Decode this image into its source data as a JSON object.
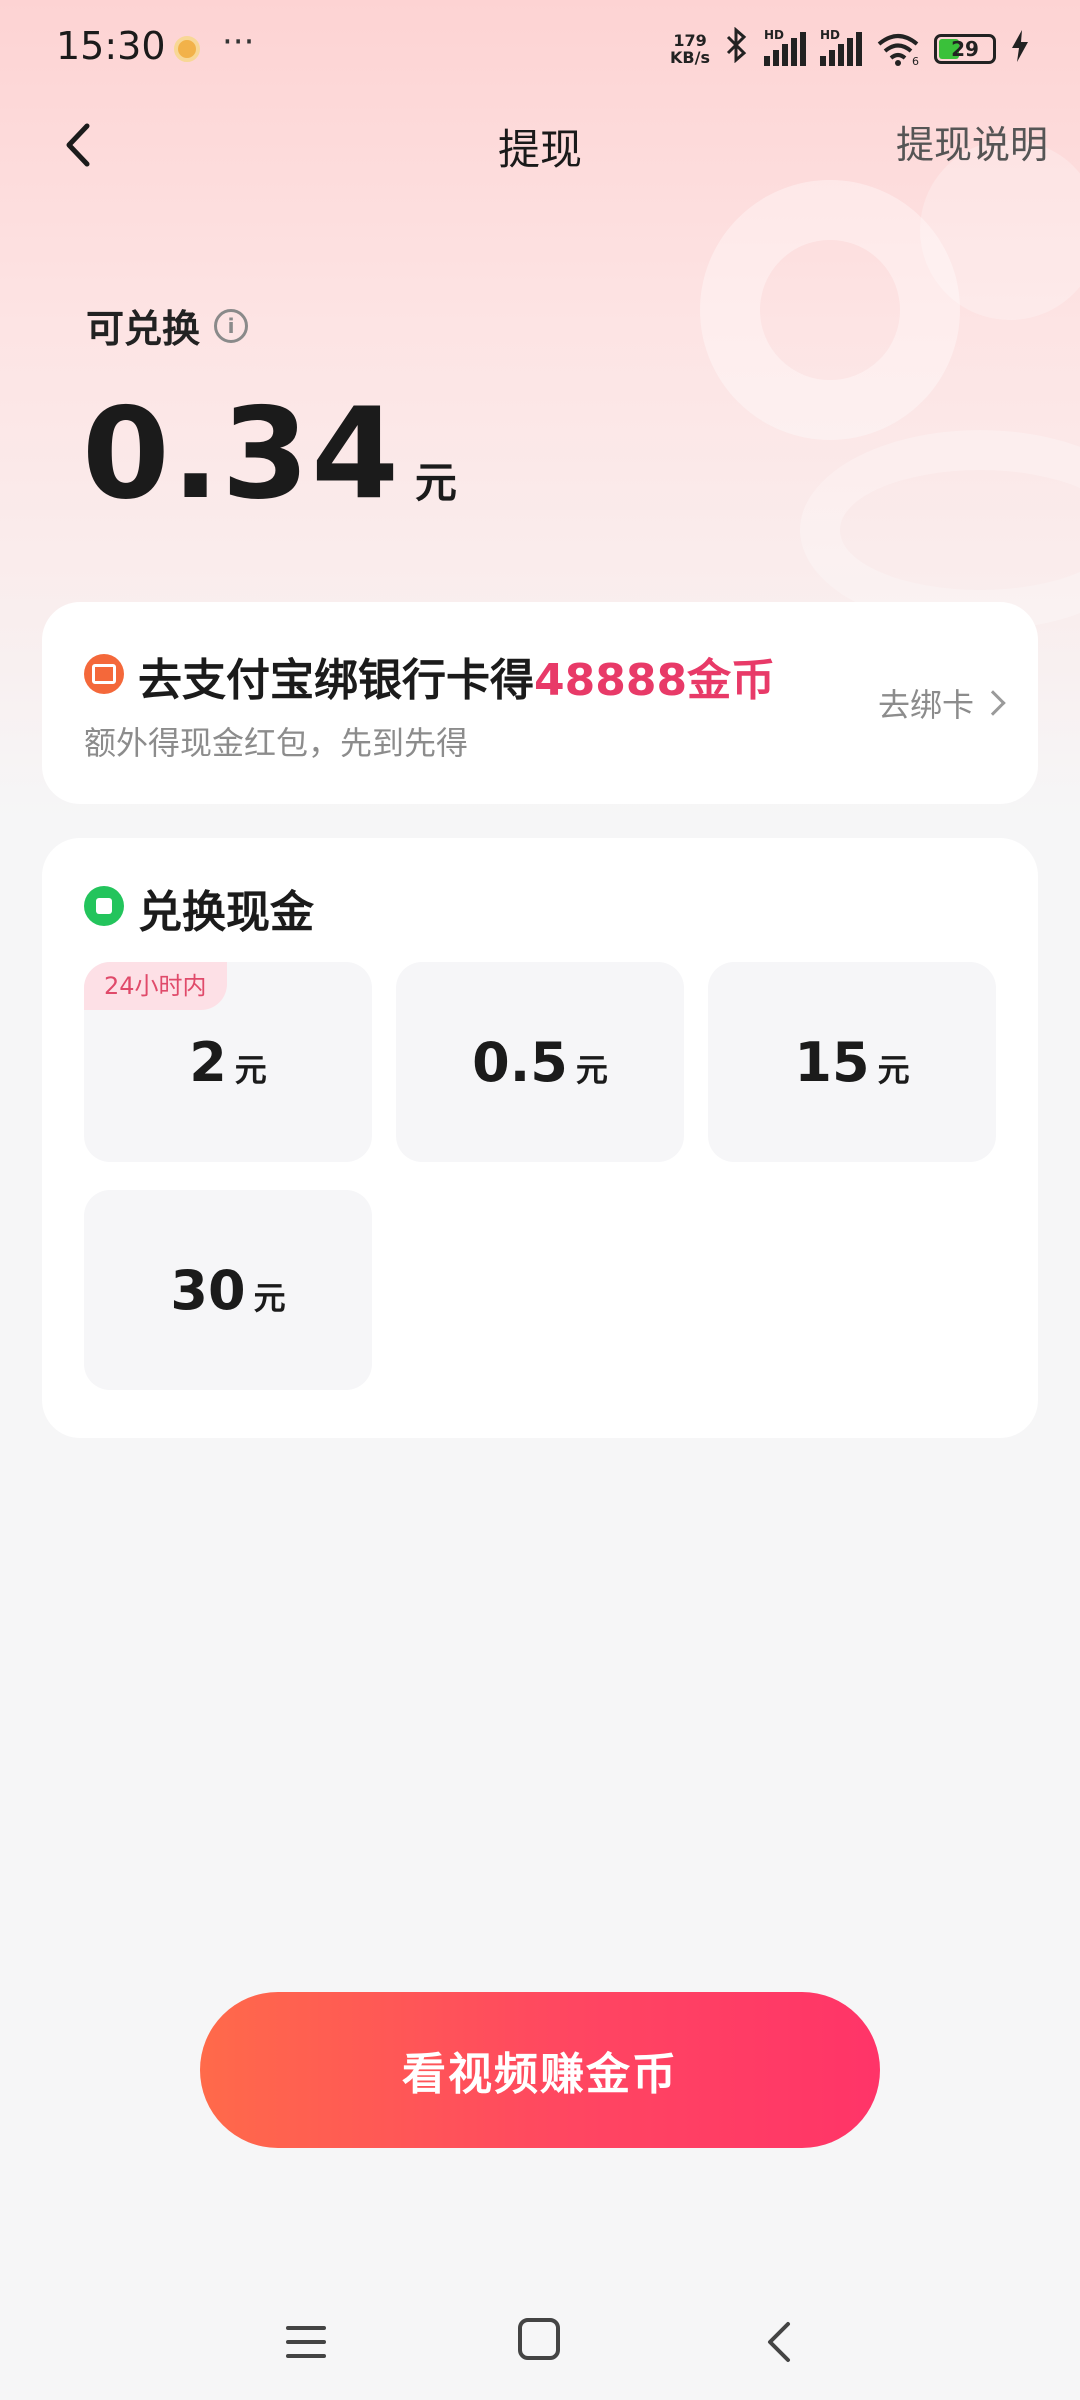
{
  "status_bar": {
    "time": "15:30",
    "more": "···",
    "net_speed_value": "179",
    "net_speed_unit": "KB/s",
    "hd_label": "HD",
    "wifi_sub": "6",
    "battery_level": "29",
    "icons": [
      "app-notification-icon",
      "bluetooth-icon",
      "signal-icon",
      "signal-icon",
      "wifi-icon",
      "battery-icon",
      "charging-icon"
    ]
  },
  "nav": {
    "title": "提现",
    "help_label": "提现说明"
  },
  "balance": {
    "label": "可兑换",
    "amount": "0.34",
    "unit": "元"
  },
  "alipay_card": {
    "title_prefix": "去支付宝绑银行卡得",
    "title_highlight": "48888金币",
    "subtitle": "额外得现金红包，先到先得",
    "action_label": "去绑卡"
  },
  "exchange": {
    "title": "兑换现金",
    "options": [
      {
        "amount": "2",
        "unit": "元",
        "badge": "24小时内"
      },
      {
        "amount": "0.5",
        "unit": "元"
      },
      {
        "amount": "15",
        "unit": "元"
      },
      {
        "amount": "30",
        "unit": "元"
      }
    ]
  },
  "cta": {
    "label": "看视频赚金币"
  },
  "colors": {
    "accent": "#e83a68",
    "button_start": "#ff6a4a",
    "button_end": "#ff3468",
    "exchange_icon": "#23c45c",
    "alipay_icon": "#f4683a"
  }
}
